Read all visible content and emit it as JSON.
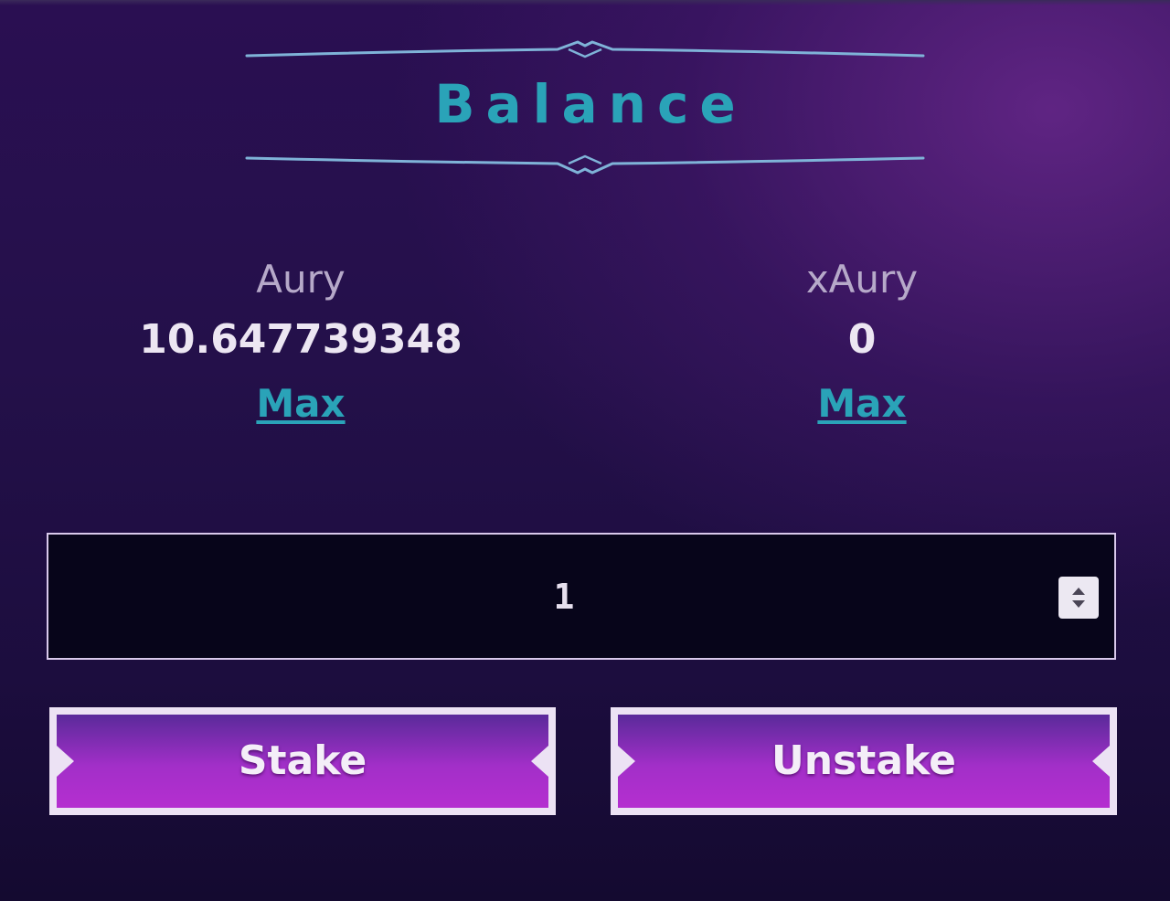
{
  "header": {
    "title": "Balance"
  },
  "balances": [
    {
      "token": "Aury",
      "amount": "10.647739348",
      "max_label": "Max"
    },
    {
      "token": "xAury",
      "amount": "0",
      "max_label": "Max"
    }
  ],
  "amount_input": {
    "value": "1"
  },
  "actions": {
    "stake_label": "Stake",
    "unstake_label": "Unstake"
  },
  "colors": {
    "accent": "#2aa3b8",
    "button_fill": "#b02fce",
    "input_background": "#07051a",
    "text_primary": "#ece6f2",
    "text_secondary": "#b6a9c9"
  },
  "icons": {
    "header_ornament": "ornate-divider-icon",
    "spinner": "up-down-spinner-icon"
  }
}
